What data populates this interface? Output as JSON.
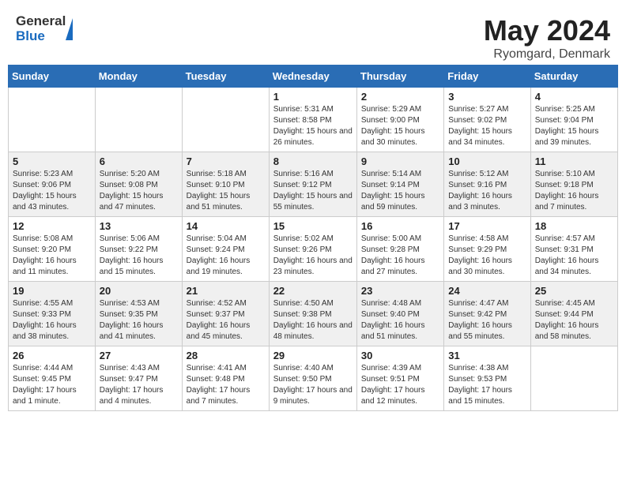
{
  "header": {
    "logo": {
      "general": "General",
      "blue": "Blue"
    },
    "title": "May 2024",
    "location": "Ryomgard, Denmark"
  },
  "days_of_week": [
    "Sunday",
    "Monday",
    "Tuesday",
    "Wednesday",
    "Thursday",
    "Friday",
    "Saturday"
  ],
  "weeks": [
    [
      {
        "day": "",
        "sunrise": "",
        "sunset": "",
        "daylight": ""
      },
      {
        "day": "",
        "sunrise": "",
        "sunset": "",
        "daylight": ""
      },
      {
        "day": "",
        "sunrise": "",
        "sunset": "",
        "daylight": ""
      },
      {
        "day": "1",
        "sunrise": "Sunrise: 5:31 AM",
        "sunset": "Sunset: 8:58 PM",
        "daylight": "Daylight: 15 hours and 26 minutes."
      },
      {
        "day": "2",
        "sunrise": "Sunrise: 5:29 AM",
        "sunset": "Sunset: 9:00 PM",
        "daylight": "Daylight: 15 hours and 30 minutes."
      },
      {
        "day": "3",
        "sunrise": "Sunrise: 5:27 AM",
        "sunset": "Sunset: 9:02 PM",
        "daylight": "Daylight: 15 hours and 34 minutes."
      },
      {
        "day": "4",
        "sunrise": "Sunrise: 5:25 AM",
        "sunset": "Sunset: 9:04 PM",
        "daylight": "Daylight: 15 hours and 39 minutes."
      }
    ],
    [
      {
        "day": "5",
        "sunrise": "Sunrise: 5:23 AM",
        "sunset": "Sunset: 9:06 PM",
        "daylight": "Daylight: 15 hours and 43 minutes."
      },
      {
        "day": "6",
        "sunrise": "Sunrise: 5:20 AM",
        "sunset": "Sunset: 9:08 PM",
        "daylight": "Daylight: 15 hours and 47 minutes."
      },
      {
        "day": "7",
        "sunrise": "Sunrise: 5:18 AM",
        "sunset": "Sunset: 9:10 PM",
        "daylight": "Daylight: 15 hours and 51 minutes."
      },
      {
        "day": "8",
        "sunrise": "Sunrise: 5:16 AM",
        "sunset": "Sunset: 9:12 PM",
        "daylight": "Daylight: 15 hours and 55 minutes."
      },
      {
        "day": "9",
        "sunrise": "Sunrise: 5:14 AM",
        "sunset": "Sunset: 9:14 PM",
        "daylight": "Daylight: 15 hours and 59 minutes."
      },
      {
        "day": "10",
        "sunrise": "Sunrise: 5:12 AM",
        "sunset": "Sunset: 9:16 PM",
        "daylight": "Daylight: 16 hours and 3 minutes."
      },
      {
        "day": "11",
        "sunrise": "Sunrise: 5:10 AM",
        "sunset": "Sunset: 9:18 PM",
        "daylight": "Daylight: 16 hours and 7 minutes."
      }
    ],
    [
      {
        "day": "12",
        "sunrise": "Sunrise: 5:08 AM",
        "sunset": "Sunset: 9:20 PM",
        "daylight": "Daylight: 16 hours and 11 minutes."
      },
      {
        "day": "13",
        "sunrise": "Sunrise: 5:06 AM",
        "sunset": "Sunset: 9:22 PM",
        "daylight": "Daylight: 16 hours and 15 minutes."
      },
      {
        "day": "14",
        "sunrise": "Sunrise: 5:04 AM",
        "sunset": "Sunset: 9:24 PM",
        "daylight": "Daylight: 16 hours and 19 minutes."
      },
      {
        "day": "15",
        "sunrise": "Sunrise: 5:02 AM",
        "sunset": "Sunset: 9:26 PM",
        "daylight": "Daylight: 16 hours and 23 minutes."
      },
      {
        "day": "16",
        "sunrise": "Sunrise: 5:00 AM",
        "sunset": "Sunset: 9:28 PM",
        "daylight": "Daylight: 16 hours and 27 minutes."
      },
      {
        "day": "17",
        "sunrise": "Sunrise: 4:58 AM",
        "sunset": "Sunset: 9:29 PM",
        "daylight": "Daylight: 16 hours and 30 minutes."
      },
      {
        "day": "18",
        "sunrise": "Sunrise: 4:57 AM",
        "sunset": "Sunset: 9:31 PM",
        "daylight": "Daylight: 16 hours and 34 minutes."
      }
    ],
    [
      {
        "day": "19",
        "sunrise": "Sunrise: 4:55 AM",
        "sunset": "Sunset: 9:33 PM",
        "daylight": "Daylight: 16 hours and 38 minutes."
      },
      {
        "day": "20",
        "sunrise": "Sunrise: 4:53 AM",
        "sunset": "Sunset: 9:35 PM",
        "daylight": "Daylight: 16 hours and 41 minutes."
      },
      {
        "day": "21",
        "sunrise": "Sunrise: 4:52 AM",
        "sunset": "Sunset: 9:37 PM",
        "daylight": "Daylight: 16 hours and 45 minutes."
      },
      {
        "day": "22",
        "sunrise": "Sunrise: 4:50 AM",
        "sunset": "Sunset: 9:38 PM",
        "daylight": "Daylight: 16 hours and 48 minutes."
      },
      {
        "day": "23",
        "sunrise": "Sunrise: 4:48 AM",
        "sunset": "Sunset: 9:40 PM",
        "daylight": "Daylight: 16 hours and 51 minutes."
      },
      {
        "day": "24",
        "sunrise": "Sunrise: 4:47 AM",
        "sunset": "Sunset: 9:42 PM",
        "daylight": "Daylight: 16 hours and 55 minutes."
      },
      {
        "day": "25",
        "sunrise": "Sunrise: 4:45 AM",
        "sunset": "Sunset: 9:44 PM",
        "daylight": "Daylight: 16 hours and 58 minutes."
      }
    ],
    [
      {
        "day": "26",
        "sunrise": "Sunrise: 4:44 AM",
        "sunset": "Sunset: 9:45 PM",
        "daylight": "Daylight: 17 hours and 1 minute."
      },
      {
        "day": "27",
        "sunrise": "Sunrise: 4:43 AM",
        "sunset": "Sunset: 9:47 PM",
        "daylight": "Daylight: 17 hours and 4 minutes."
      },
      {
        "day": "28",
        "sunrise": "Sunrise: 4:41 AM",
        "sunset": "Sunset: 9:48 PM",
        "daylight": "Daylight: 17 hours and 7 minutes."
      },
      {
        "day": "29",
        "sunrise": "Sunrise: 4:40 AM",
        "sunset": "Sunset: 9:50 PM",
        "daylight": "Daylight: 17 hours and 9 minutes."
      },
      {
        "day": "30",
        "sunrise": "Sunrise: 4:39 AM",
        "sunset": "Sunset: 9:51 PM",
        "daylight": "Daylight: 17 hours and 12 minutes."
      },
      {
        "day": "31",
        "sunrise": "Sunrise: 4:38 AM",
        "sunset": "Sunset: 9:53 PM",
        "daylight": "Daylight: 17 hours and 15 minutes."
      },
      {
        "day": "",
        "sunrise": "",
        "sunset": "",
        "daylight": ""
      }
    ]
  ]
}
